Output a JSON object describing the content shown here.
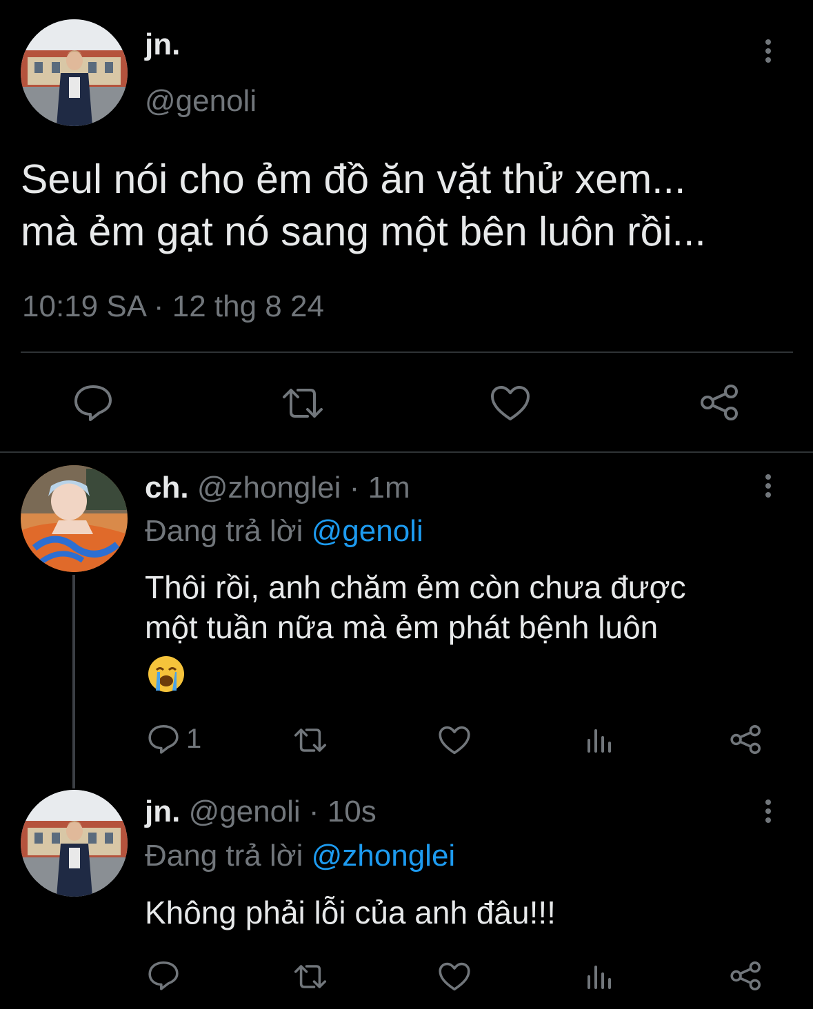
{
  "main_tweet": {
    "display_name": "jn.",
    "handle": "@genoli",
    "text_line1": "Seul nói cho ẻm đồ ăn vặt thử xem...",
    "text_line2": "mà ẻm gạt nó sang một bên luôn rồi...",
    "time": "10:19 SA",
    "separator": "·",
    "date": "12 thg 8 24",
    "actions": [
      "reply-icon",
      "retweet-icon",
      "like-icon",
      "share-icon"
    ]
  },
  "reply1": {
    "display_name": "ch.",
    "handle": "@zhonglei",
    "separator": "·",
    "time_ago": "1m",
    "replying_prefix": "Đang trả lời",
    "replying_to": "@genoli",
    "text_line1": "Thôi rồi, anh chăm ẻm còn chưa được",
    "text_line2": "một tuần nữa mà ẻm phát bệnh luôn",
    "emoji": "😭",
    "reply_count": "1"
  },
  "reply2": {
    "display_name": "jn.",
    "handle": "@genoli",
    "separator": "·",
    "time_ago": "10s",
    "replying_prefix": "Đang trả lời",
    "replying_to": "@zhonglei",
    "text": "Không phải lỗi của anh đâu!!!"
  },
  "colors": {
    "background": "#000000",
    "text": "#e7e9ea",
    "muted": "#71767b",
    "link": "#1d9bf0",
    "divider": "#2f3336"
  }
}
